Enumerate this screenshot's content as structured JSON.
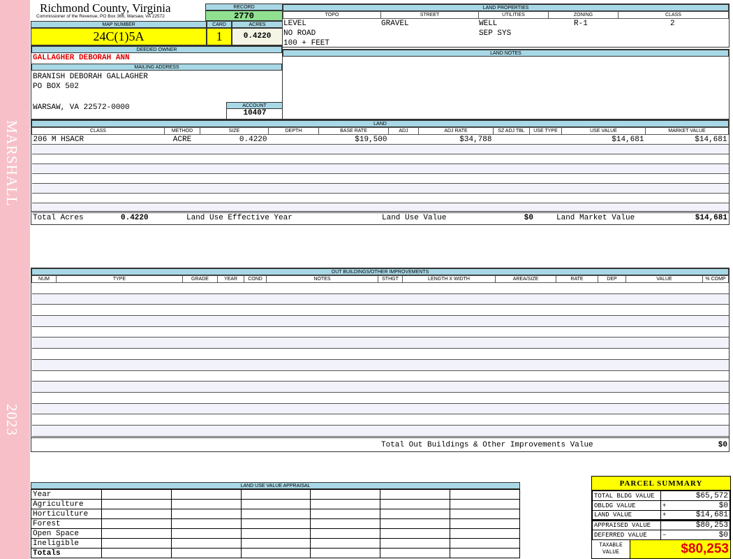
{
  "sidebar": {
    "name": "MARSHALL",
    "year": "2023"
  },
  "header": {
    "title": "Richmond County, Virginia",
    "subtitle": "Commissioner of the Revenue, PO Box 366, Warsaw, VA 22572",
    "record_label": "RECORD",
    "record": "2770",
    "map_label": "MAP NUMBER",
    "map": "24C(1)5A",
    "card_label": "CARD",
    "card": "1",
    "acres_label": "ACRES",
    "acres": "0.4220"
  },
  "owner": {
    "label": "DEEDED OWNER",
    "name": "GALLAGHER DEBORAH ANN",
    "mail_label": "MAILING ADDRESS",
    "line1": "BRANISH DEBORAH GALLAGHER",
    "line2": "PO BOX 502",
    "line3": "WARSAW, VA 22572-0000",
    "account_label": "ACCOUNT",
    "account": "10407"
  },
  "land_properties": {
    "label": "LAND PROPERTIES",
    "headers": [
      "TOPO",
      "STREET",
      "UTILITIES",
      "ZONING",
      "CLASS"
    ],
    "topo": [
      "LEVEL",
      "NO ROAD",
      "100 + FEET"
    ],
    "street": "GRAVEL",
    "utilities": [
      "WELL",
      "SEP SYS"
    ],
    "zoning": "R-1",
    "class": "2"
  },
  "land_notes": {
    "label": "LAND NOTES"
  },
  "land": {
    "label": "LAND",
    "headers": [
      "CLASS",
      "METHOD",
      "SIZE",
      "DEPTH",
      "BASE RATE",
      "ADJ",
      "ADJ RATE",
      "SZ ADJ TBL",
      "USE TYPE",
      "USE VALUE",
      "MARKET VALUE"
    ],
    "rows": [
      [
        "206 M HSACR",
        "ACRE",
        "0.4220",
        "",
        "$19,500",
        "",
        "$34,788",
        "",
        "",
        "$14,681",
        "$14,681"
      ]
    ],
    "total_acres_label": "Total Acres",
    "total_acres": "0.4220",
    "effective_year_label": "Land Use Effective Year",
    "use_value_label": "Land Use Value",
    "use_value": "$0",
    "market_value_label": "Land Market Value",
    "market_value": "$14,681"
  },
  "outbuildings": {
    "label": "OUT BUILDINGS/OTHER IMPROVEMENTS",
    "headers": [
      "NUM",
      "TYPE",
      "GRADE",
      "YEAR",
      "COND",
      "NOTES",
      "STHGT",
      "LENGTH X WIDTH",
      "AREA/SIZE",
      "RATE",
      "DEP",
      "VALUE",
      "% COMP"
    ],
    "total_label": "Total Out Buildings & Other Improvements Value",
    "total": "$0"
  },
  "land_use": {
    "label": "LAND USE VALUE APPRAISAL",
    "year_label": "Year",
    "rows": [
      "Agriculture",
      "Horticulture",
      "Forest",
      "Open Space",
      "Ineligible"
    ],
    "totals_label": "Totals"
  },
  "parcel_summary": {
    "title": "PARCEL SUMMARY",
    "rows": [
      {
        "label": "TOTAL BLDG VALUE",
        "sign": "",
        "value": "$65,572"
      },
      {
        "label": "OBLDG VALUE",
        "sign": "+",
        "value": "$0"
      },
      {
        "label": "LAND VALUE",
        "sign": "+",
        "value": "$14,681"
      },
      {
        "label": "APPRAISED VALUE",
        "sign": "",
        "value": "$80,253"
      },
      {
        "label": "DEFERRED VALUE",
        "sign": "−",
        "value": "$0"
      }
    ],
    "taxable_label": "TAXABLE VALUE",
    "taxable": "$80,253"
  },
  "colors": {
    "header_blue": "#a8d8e6",
    "yellow": "#ffff00",
    "green": "#90e090",
    "red": "#e00000",
    "pink": "#f7c0c8"
  }
}
